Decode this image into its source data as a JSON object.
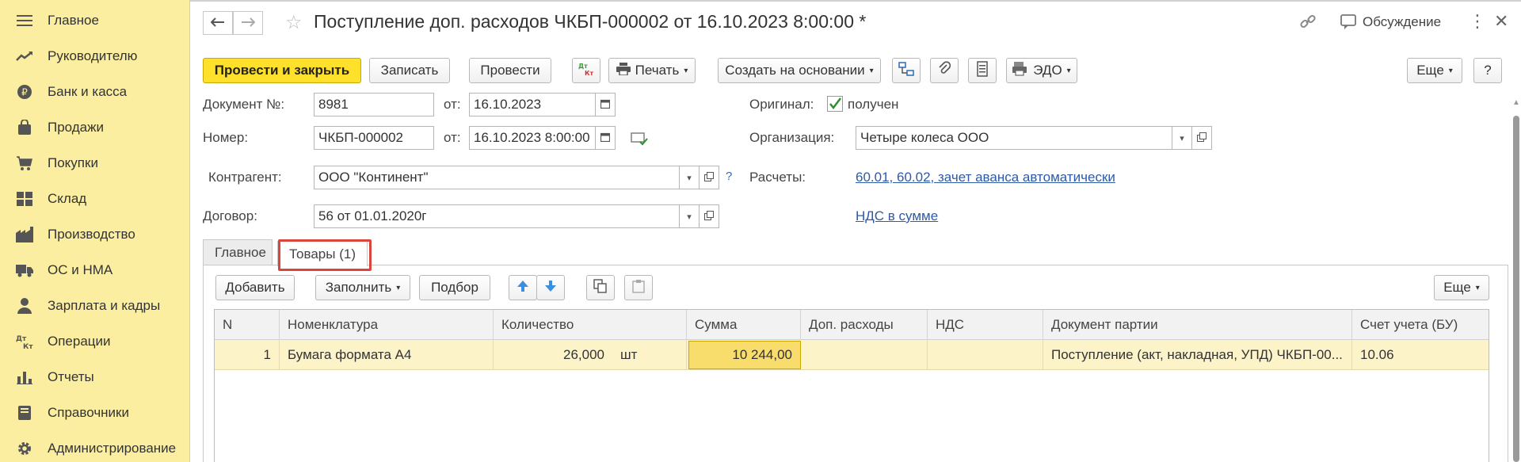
{
  "sidebar": {
    "items": [
      {
        "label": "Главное",
        "icon": "menu-icon"
      },
      {
        "label": "Руководителю",
        "icon": "trend-icon"
      },
      {
        "label": "Банк и касса",
        "icon": "ruble-coin-icon"
      },
      {
        "label": "Продажи",
        "icon": "bag-icon"
      },
      {
        "label": "Покупки",
        "icon": "cart-icon"
      },
      {
        "label": "Склад",
        "icon": "warehouse-icon"
      },
      {
        "label": "Производство",
        "icon": "factory-icon"
      },
      {
        "label": "ОС и НМА",
        "icon": "truck-icon"
      },
      {
        "label": "Зарплата и кадры",
        "icon": "person-icon"
      },
      {
        "label": "Операции",
        "icon": "debit-credit-icon"
      },
      {
        "label": "Отчеты",
        "icon": "bar-chart-icon"
      },
      {
        "label": "Справочники",
        "icon": "book-icon"
      },
      {
        "label": "Администрирование",
        "icon": "gear-icon"
      }
    ]
  },
  "header": {
    "title": "Поступление доп. расходов ЧКБП-000002 от 16.10.2023 8:00:00 *",
    "discussion": "Обсуждение"
  },
  "toolbar": {
    "post_close": "Провести и закрыть",
    "save": "Записать",
    "post": "Провести",
    "dtkt": "Дт Кт",
    "print": "Печать",
    "create_based": "Создать на основании",
    "edo": "ЭДО",
    "more": "Еще",
    "help": "?"
  },
  "form": {
    "doc_no_label": "Документ №:",
    "doc_no": "8981",
    "from_label": "от:",
    "doc_date": "16.10.2023",
    "number_label": "Номер:",
    "number": "ЧКБП-000002",
    "number_date": "16.10.2023  8:00:00",
    "original_label": "Оригинал:",
    "original_value": "получен",
    "org_label": "Организация:",
    "org": "Четыре колеса ООО",
    "counterparty_label": "Контрагент:",
    "counterparty": "ООО \"Континент\"",
    "settlements_label": "Расчеты:",
    "settlements_link": "60.01, 60.02, зачет аванса автоматически",
    "contract_label": "Договор:",
    "contract": "56 от 01.01.2020г",
    "vat_link": "НДС в сумме",
    "help_q": "?"
  },
  "tabs": [
    {
      "label": "Главное"
    },
    {
      "label": "Товары (1)"
    }
  ],
  "table_toolbar": {
    "add": "Добавить",
    "fill": "Заполнить",
    "pick": "Подбор",
    "more": "Еще"
  },
  "table": {
    "columns": [
      "N",
      "Номенклатура",
      "Количество",
      "Сумма",
      "Доп. расходы",
      "НДС",
      "Документ партии",
      "Счет учета (БУ)"
    ],
    "rows": [
      {
        "n": "1",
        "item": "Бумага формата А4",
        "qty": "26,000",
        "unit": "шт",
        "sum": "10 244,00",
        "extra": "",
        "vat": "",
        "batch_doc": "Поступление (акт, накладная, УПД) ЧКБП-00...",
        "account": "10.06"
      }
    ]
  },
  "colors": {
    "sidebar_bg": "#fbeea0",
    "primary_button": "#ffe02a",
    "link": "#2e5aa8",
    "selected_row": "#fcf4c8",
    "tab_highlight": "#d9463e"
  }
}
